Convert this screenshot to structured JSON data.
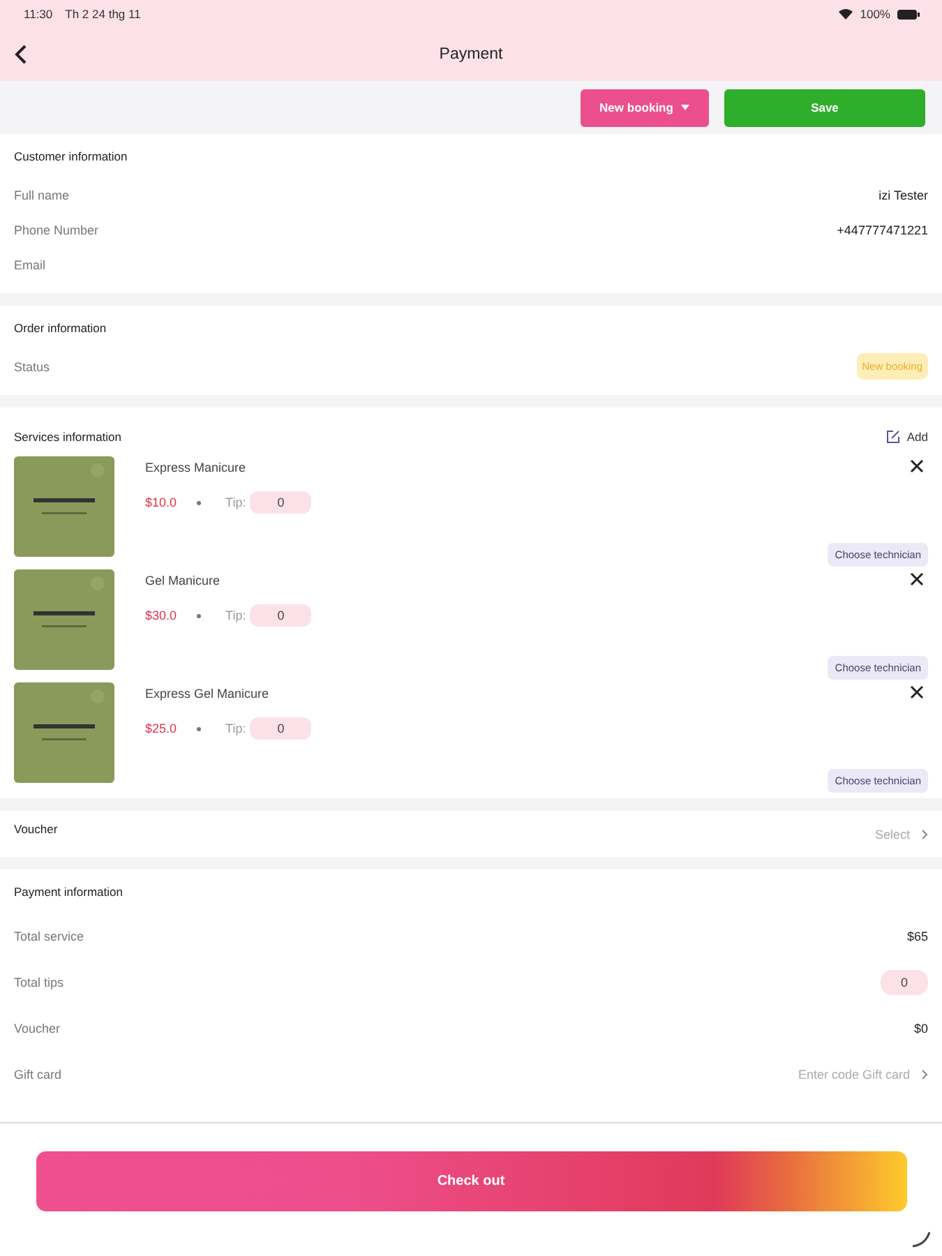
{
  "status_bar": {
    "time": "11:30",
    "date": "Th 2 24 thg 11",
    "battery": "100%"
  },
  "nav": {
    "title": "Payment"
  },
  "actions": {
    "new_booking": "New booking",
    "save": "Save"
  },
  "customer": {
    "title": "Customer information",
    "fields": [
      {
        "label": "Full name",
        "value": "izi Tester"
      },
      {
        "label": "Phone Number",
        "value": "+447777471221"
      },
      {
        "label": "Email"
      }
    ]
  },
  "order": {
    "title": "Order information",
    "status_label": "Status",
    "status": "New booking"
  },
  "services": {
    "title": "Services information",
    "add": "Add",
    "items": [
      {
        "kind": "picture",
        "name": "Express Manicure",
        "price": "$10.0",
        "tip_label": "Tip:",
        "tip": "0",
        "technician": "Choose technician"
      },
      {
        "kind": "picture",
        "name": "Gel Manicure",
        "price": "$30.0",
        "tip_label": "Tip:",
        "tip": "0",
        "technician": "Choose technician"
      },
      {
        "kind": "picture",
        "name": "Express Gel Manicure",
        "price": "$25.0",
        "tip_label": "Tip:",
        "tip": "0",
        "technician": "Choose technician"
      }
    ]
  },
  "voucher": {
    "label": "Voucher",
    "placeholder": "Select"
  },
  "payment": {
    "title": "Payment information",
    "rows": [
      {
        "kind": "text",
        "label": "Total service",
        "value": "$65"
      },
      {
        "kind": "pill",
        "label": "Total tips",
        "value": "0"
      },
      {
        "kind": "text",
        "label": "Voucher",
        "value": "$0"
      },
      {
        "kind": "input",
        "label": "Gift card",
        "placeholder": "Enter code Gift card"
      }
    ]
  },
  "checkout": "Check out"
}
